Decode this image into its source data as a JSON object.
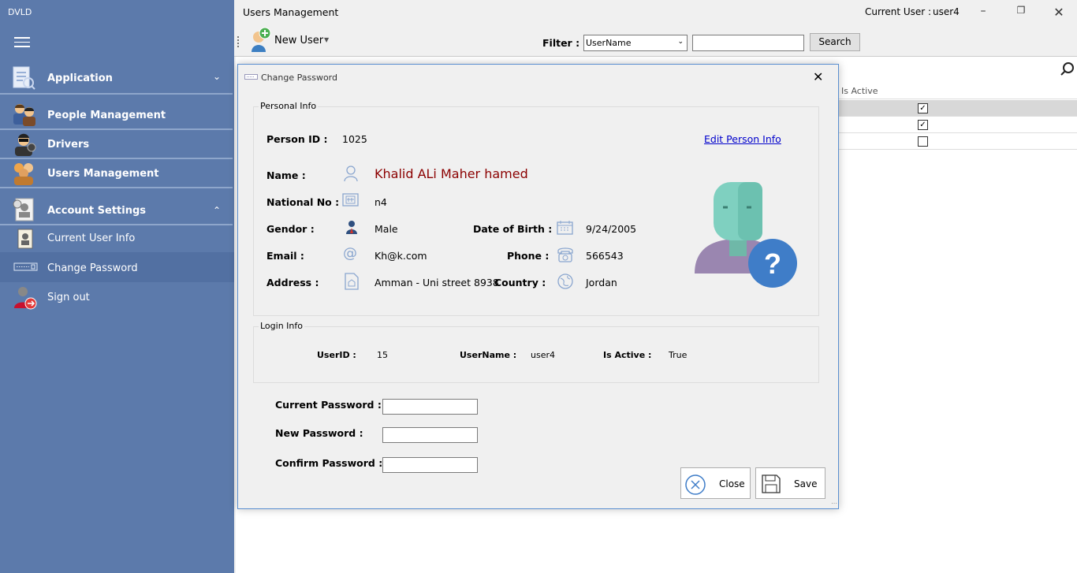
{
  "sidebar": {
    "app_name": "DVLD",
    "items": [
      {
        "label": "Application"
      },
      {
        "label": "People Management"
      },
      {
        "label": "Drivers"
      },
      {
        "label": "Users Management"
      },
      {
        "label": "Account Settings"
      },
      {
        "label": "Current User Info"
      },
      {
        "label": "Change Password"
      },
      {
        "label": "Sign out"
      }
    ]
  },
  "window": {
    "title": "Users Management",
    "current_user_label": "Current User :",
    "current_user_value": "user4"
  },
  "toolbar": {
    "new_user_label": "New User",
    "filter_label": "Filter :",
    "filter_selected": "UserName",
    "filter_value": "",
    "search_label": "Search"
  },
  "grid": {
    "column_header": "Is Active",
    "rows": [
      {
        "is_active": true
      },
      {
        "is_active": true
      },
      {
        "is_active": false
      }
    ]
  },
  "dialog": {
    "title": "Change Password",
    "personal_info": {
      "group_title": "Personal Info",
      "person_id_label": "Person ID :",
      "person_id": "1025",
      "edit_link": "Edit Person Info",
      "name_label": "Name :",
      "name": "Khalid ALi Maher hamed",
      "national_no_label": "National No :",
      "national_no": "n4",
      "gender_label": "Gendor :",
      "gender": "Male",
      "dob_label": "Date of Birth :",
      "dob": "9/24/2005",
      "email_label": "Email :",
      "email": "Kh@k.com",
      "phone_label": "Phone :",
      "phone": "566543",
      "address_label": "Address :",
      "address": "Amman - Uni street 8938",
      "country_label": "Country :",
      "country": "Jordan"
    },
    "login_info": {
      "group_title": "Login Info",
      "user_id_label": "UserID :",
      "user_id": "15",
      "username_label": "UserName :",
      "username": "user4",
      "is_active_label": "Is Active :",
      "is_active": "True"
    },
    "current_password_label": "Current Password :",
    "new_password_label": "New Password :",
    "confirm_password_label": "Confirm Password :",
    "current_password": "",
    "new_password": "",
    "confirm_password": "",
    "close_label": "Close",
    "save_label": "Save"
  },
  "colors": {
    "sidebar_bg": "#5c7aab",
    "name_text": "#8b0000",
    "link": "#0000cc"
  }
}
